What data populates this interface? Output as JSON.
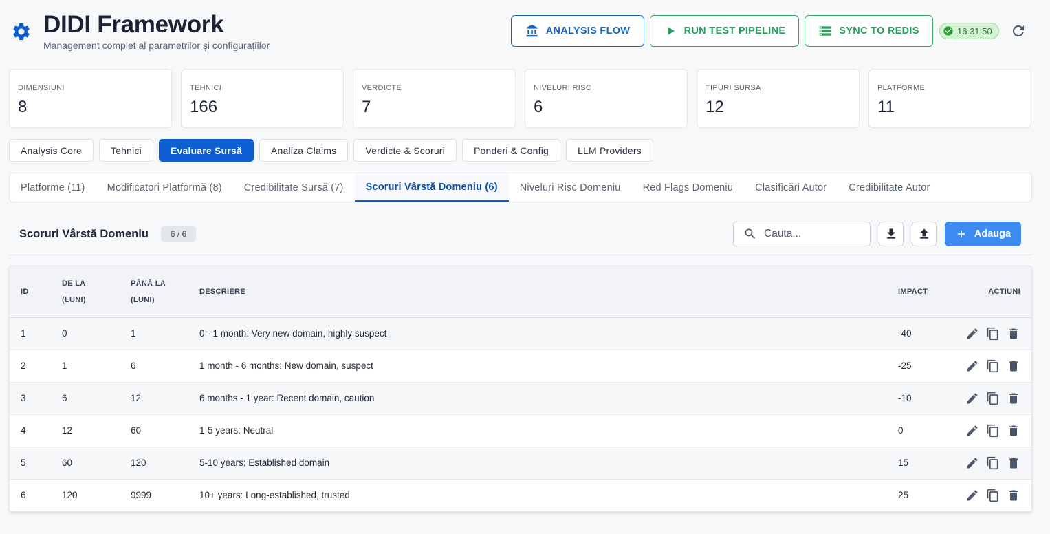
{
  "header": {
    "title": "DIDI Framework",
    "subtitle": "Management complet al parametrilor și configurațiilor",
    "buttons": {
      "analysis_flow": "ANALYSIS FLOW",
      "run_test_pipeline": "RUN TEST PIPELINE",
      "sync_to_redis": "SYNC TO REDIS"
    },
    "time": "16:31:50"
  },
  "colors": {
    "primary": "#0d5ed3",
    "accent_blue_button": "#3d8bf0",
    "success": "#24a05a",
    "time_chip_bg": "#d5f2d4"
  },
  "stats": [
    {
      "label": "DIMENSIUNI",
      "value": "8"
    },
    {
      "label": "TEHNICI",
      "value": "166"
    },
    {
      "label": "VERDICTE",
      "value": "7"
    },
    {
      "label": "NIVELURI RISC",
      "value": "6"
    },
    {
      "label": "TIPURI SURSA",
      "value": "12"
    },
    {
      "label": "PLATFORME",
      "value": "11"
    }
  ],
  "categories": [
    {
      "label": "Analysis Core",
      "active": false
    },
    {
      "label": "Tehnici",
      "active": false
    },
    {
      "label": "Evaluare Sursă",
      "active": true
    },
    {
      "label": "Analiza Claims",
      "active": false
    },
    {
      "label": "Verdicte & Scoruri",
      "active": false
    },
    {
      "label": "Ponderi & Config",
      "active": false
    },
    {
      "label": "LLM Providers",
      "active": false
    }
  ],
  "subtabs": [
    {
      "label": "Platforme (11)",
      "active": false
    },
    {
      "label": "Modificatori Platformă (8)",
      "active": false
    },
    {
      "label": "Credibilitate Sursă (7)",
      "active": false
    },
    {
      "label": "Scoruri Vârstă Domeniu (6)",
      "active": true
    },
    {
      "label": "Niveluri Risc Domeniu",
      "active": false
    },
    {
      "label": "Red Flags Domeniu",
      "active": false
    },
    {
      "label": "Clasificări Autor",
      "active": false
    },
    {
      "label": "Credibilitate Autor",
      "active": false
    }
  ],
  "panel": {
    "title": "Scoruri Vârstă Domeniu",
    "count": "6 / 6",
    "search_placeholder": "Cauta...",
    "add_label": "Adauga"
  },
  "table": {
    "columns": {
      "id": "ID",
      "from_line1": "DE LA",
      "from_line2": "(LUNI)",
      "to_line1": "PÂNĂ LA",
      "to_line2": "(LUNI)",
      "description": "DESCRIERE",
      "impact": "IMPACT",
      "actions": "ACTIUNI"
    },
    "rows": [
      {
        "id": "1",
        "from": "0",
        "to": "1",
        "description": "0 - 1 month: Very new domain, highly suspect",
        "impact": "-40"
      },
      {
        "id": "2",
        "from": "1",
        "to": "6",
        "description": "1 month - 6 months: New domain, suspect",
        "impact": "-25"
      },
      {
        "id": "3",
        "from": "6",
        "to": "12",
        "description": "6 months - 1 year: Recent domain, caution",
        "impact": "-10"
      },
      {
        "id": "4",
        "from": "12",
        "to": "60",
        "description": "1-5 years: Neutral",
        "impact": "0"
      },
      {
        "id": "5",
        "from": "60",
        "to": "120",
        "description": "5-10 years: Established domain",
        "impact": "15"
      },
      {
        "id": "6",
        "from": "120",
        "to": "9999",
        "description": "10+ years: Long-established, trusted",
        "impact": "25"
      }
    ]
  }
}
